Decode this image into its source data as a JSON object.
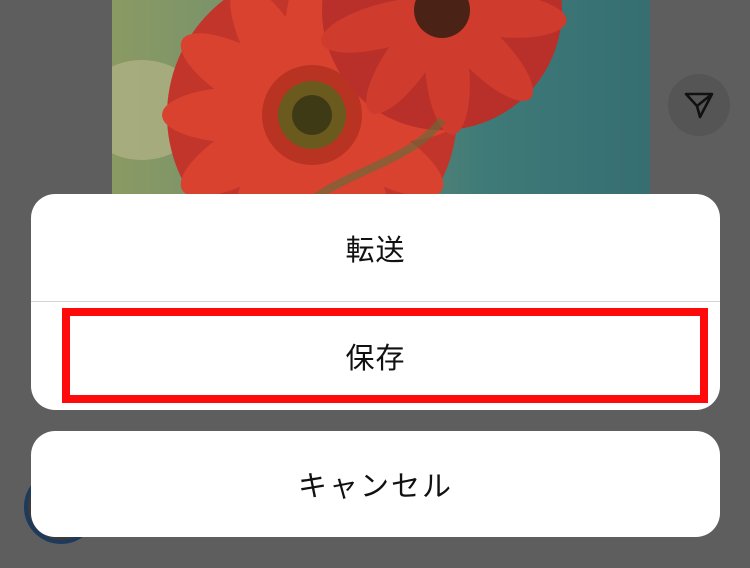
{
  "action_sheet": {
    "items": [
      {
        "label": "転送",
        "icon": ""
      },
      {
        "label": "保存",
        "icon": ""
      }
    ],
    "cancel_label": "キャンセル",
    "highlight_color": "#ff0a0a"
  },
  "background": {
    "image": "red-gerbera-flowers-photo",
    "share_icon": "send-paper-plane-icon"
  }
}
